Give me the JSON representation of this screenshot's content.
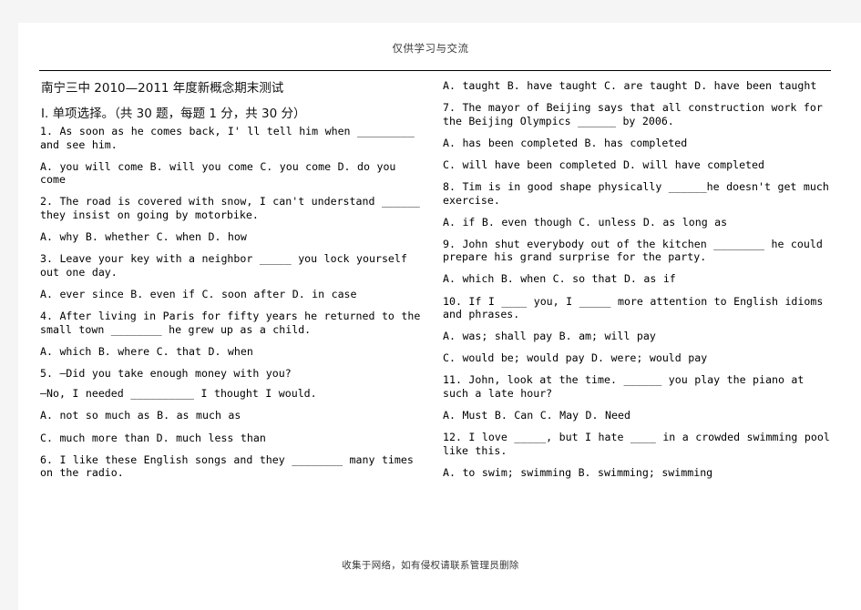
{
  "document": {
    "header_watermark": "仅供学习与交流",
    "footer_watermark": "收集于网络，如有侵权请联系管理员删除",
    "title": "南宁三中 2010—2011 年度新概念期末测试",
    "section_heading": "Ⅰ. 单项选择。（共 30 题，每题 1 分，共 30 分）"
  },
  "left_column": {
    "blocks": [
      "1. As soon as he comes back, I' ll tell him when _________ and see him.",
      " A. you will come     B. will you come    C. you come       D. do you come",
      "2. The road is covered with snow, I can't understand ______ they insist on going by motorbike.",
      "A. why        B. whether       C. when       D. how",
      "3. Leave your key with a neighbor _____ you lock yourself out one day.",
      "A. ever since          B. even if       C. soon after      D. in case",
      "4. After living in Paris for fifty years he returned to the small town ________ he grew up as a child.",
      "A. which             B. where        C. that        D. when",
      "5. —Did you take enough money with you?",
      "—No, I needed __________ I thought I would.",
      " A. not so much as     B. as much as",
      " C. much more than    D. much less than",
      "6. I like these English songs and they ________ many times on the radio."
    ]
  },
  "right_column": {
    "blocks": [
      "A. taught          B. have taught C. are taught          D. have been taught",
      "7. The mayor of Beijing says that all construction work for the Beijing Olympics ______ by 2006.",
      "A. has been completed             B. has completed",
      "C. will have been completed   D. will have completed",
      "8. Tim is in good shape physically ______he doesn't get much exercise.",
      "A. if             B. even though       C. unless      D. as long as",
      "9. John shut everybody out of the kitchen ________ he could prepare his grand surprise for the party.",
      "A. which       B. when       C. so that     D. as if",
      "10. If I ____ you, I _____ more attention to English idioms and phrases.",
      "A. was; shall pay              B. am; will pay",
      "C. would be; would pay     D. were; would pay",
      "11. John, look at the time. ______ you play the piano at such a late hour?",
      "A. Must          B. Can      C. May          D. Need",
      " 12. I love _____, but I hate ____ in a crowded swimming pool like this.",
      " A. to swim; swimming     B. swimming; swimming"
    ]
  }
}
